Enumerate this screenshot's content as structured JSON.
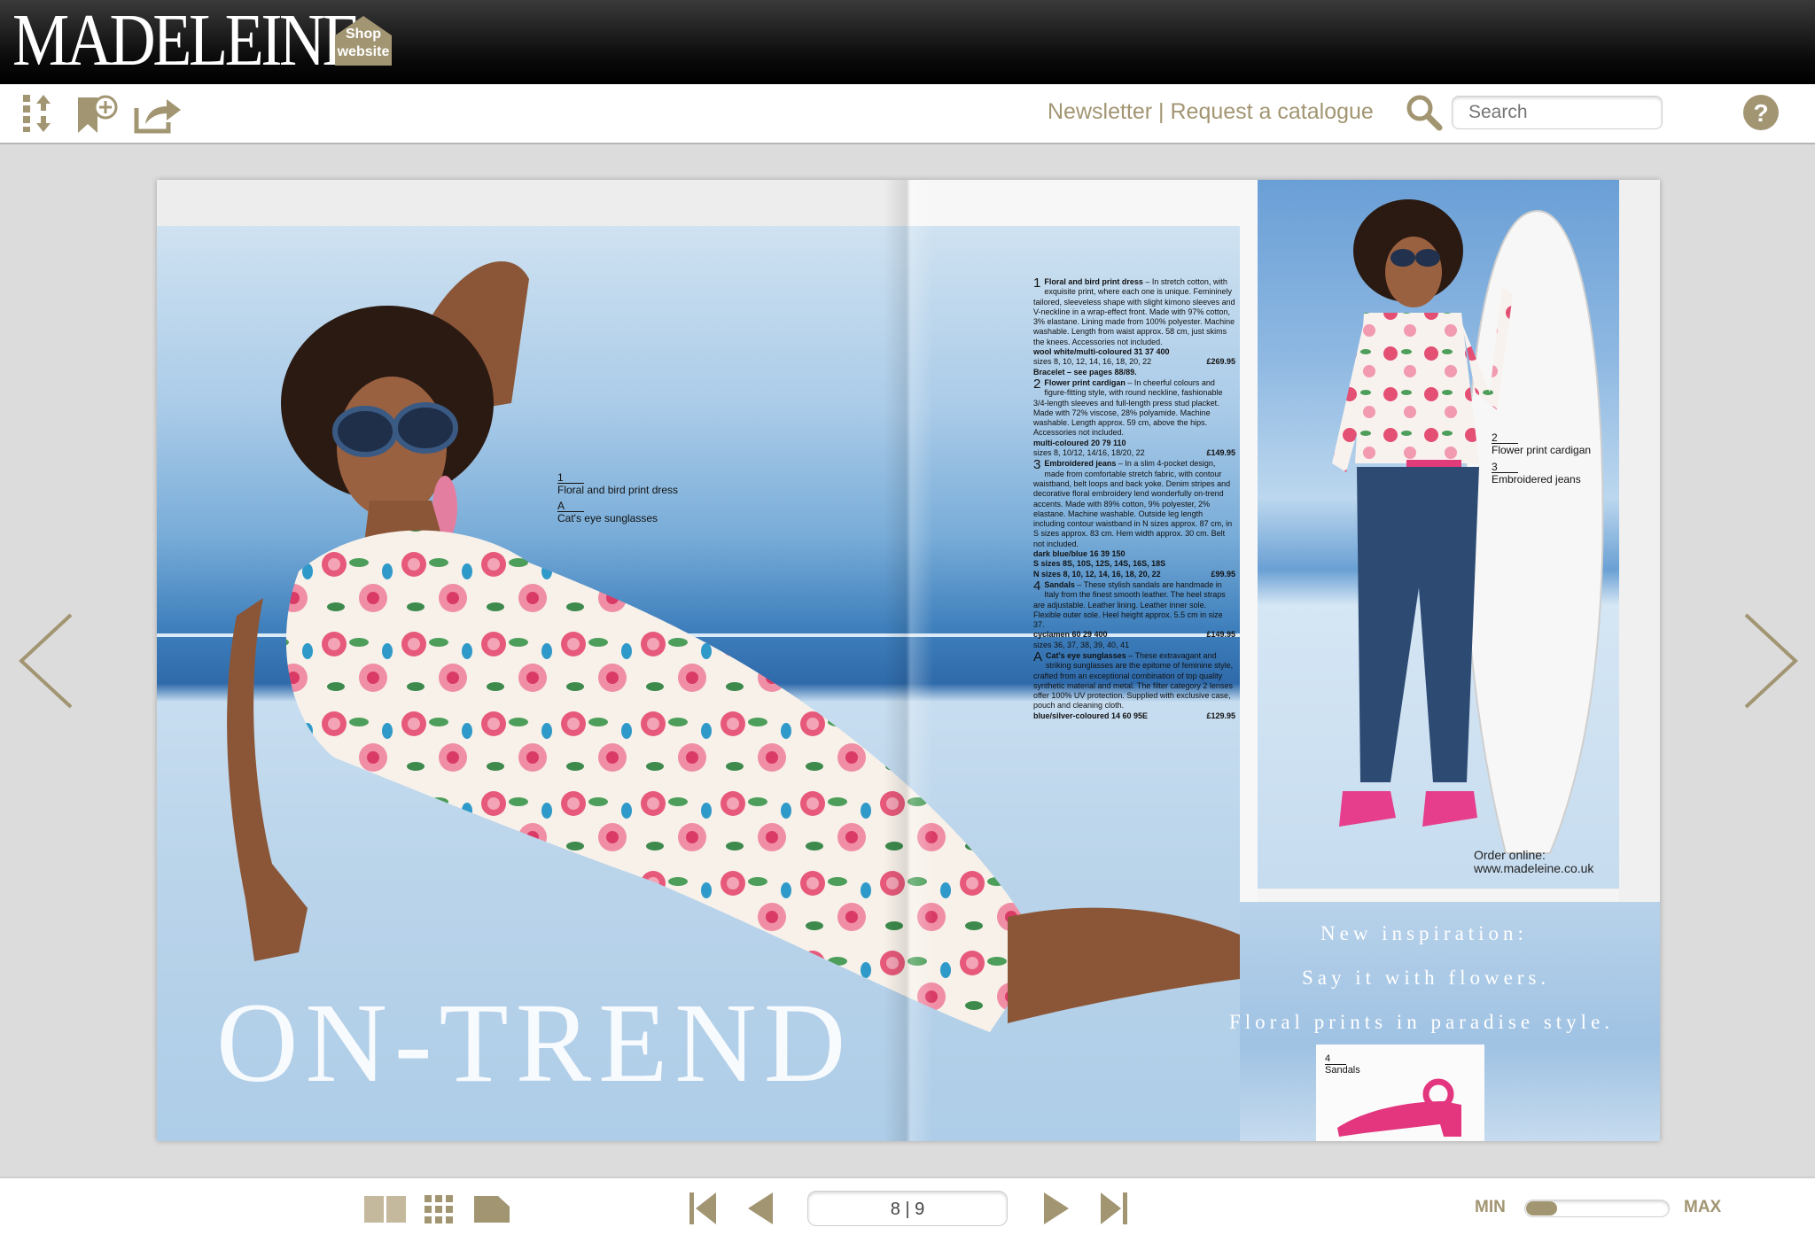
{
  "header": {
    "logo": "MADELEINE",
    "shop_button": {
      "line1": "Shop",
      "line2": "website"
    }
  },
  "toolbar": {
    "icons": [
      "sort-icon",
      "bookmark-add-icon",
      "share-icon"
    ],
    "newsletter": "Newsletter",
    "separator": " | ",
    "request_catalogue": "Request a catalogue",
    "search_placeholder": "Search"
  },
  "magazine": {
    "callouts_left": [
      {
        "num": "1",
        "label": "Floral and bird print dress"
      },
      {
        "num": "A",
        "label": "Cat's eye sunglasses"
      }
    ],
    "callouts_right": [
      {
        "num": "2",
        "label": "Flower print cardigan"
      },
      {
        "num": "3",
        "label": "Embroidered jeans"
      }
    ],
    "sandal_callout": {
      "num": "4",
      "label": "Sandals"
    },
    "order_online": {
      "line1": "Order online:",
      "line2": "www.madeleine.co.uk"
    },
    "taglines": [
      "New inspiration:",
      "Say it with flowers.",
      "Floral prints in paradise style."
    ],
    "headline": "ON-TREND",
    "products": [
      {
        "num": "1",
        "title": "Floral and bird print dress",
        "desc": " – In stretch cotton, with exquisite print, where each one is unique. Femininely tailored, sleeveless shape with slight kimono sleeves and V-neckline in a wrap-effect front. Made with 97% cotton, 3% elastane. Lining made from 100% polyester. Machine washable. Length from waist approx. 58 cm, just skims the knees. Accessories not included.",
        "colour": "wool white/multi-coloured 31 37 400",
        "sizes": "sizes   8, 10, 12, 14, 16, 18, 20, 22",
        "price": "£269.95",
        "extra": "Bracelet – see pages 88/89."
      },
      {
        "num": "2",
        "title": "Flower print cardigan",
        "desc": " – In cheerful colours and figure-fitting style, with round neckline, fashionable 3/4-length sleeves and full-length press stud placket. Made with 72% viscose, 28% polyamide. Machine washable. Length approx. 59 cm, above the hips. Accessories not included.",
        "colour": "multi-coloured 20 79 110",
        "sizes": "sizes   8, 10/12, 14/16, 18/20, 22",
        "price": "£149.95",
        "extra": ""
      },
      {
        "num": "3",
        "title": "Embroidered jeans",
        "desc": " – In a slim 4-pocket design, made from comfortable stretch fabric, with contour waistband, belt loops and back yoke. Denim stripes and decorative floral embroidery lend wonderfully on-trend accents. Made with 89% cotton, 9% polyester, 2% elastane. Machine washable. Outside leg length including contour waistband in N sizes approx. 87 cm, in S sizes approx. 83 cm. Hem width approx. 30 cm. Belt not included.",
        "colour": "dark blue/blue 16 39 150",
        "sizes": "S sizes 8S, 10S, 12S, 14S, 16S, 18S",
        "sizes2": "N sizes 8, 10, 12, 14, 16, 18, 20, 22",
        "price": "£99.95",
        "extra": ""
      },
      {
        "num": "4",
        "title": "Sandals",
        "desc": " – These stylish sandals are handmade in Italy from the finest smooth leather. The heel straps are adjustable. Leather lining. Leather inner sole. Flexible outer sole. Heel height approx. 5.5 cm in size 37.",
        "colour": "cyclamen 60 29 400",
        "sizes": "sizes   36, 37, 38, 39, 40, 41",
        "price": "£149.95",
        "extra": ""
      },
      {
        "num": "A",
        "title": "Cat's eye sunglasses",
        "desc": " – These extravagant and striking sunglasses are the epitome of feminine style, crafted from an exceptional combination of top quality synthetic material and metal. The filter category 2 lenses offer 100% UV protection. Supplied with exclusive case, pouch and cleaning cloth.",
        "colour": "blue/silver-coloured 14 60 95E",
        "sizes": "",
        "price": "£129.95",
        "extra": ""
      }
    ]
  },
  "bottombar": {
    "page_indicator": "8 | 9",
    "zoom_min": "MIN",
    "zoom_max": "MAX",
    "zoom_level": 0.22
  },
  "colors": {
    "accent": "#a29572",
    "header_bg": "#000000"
  }
}
